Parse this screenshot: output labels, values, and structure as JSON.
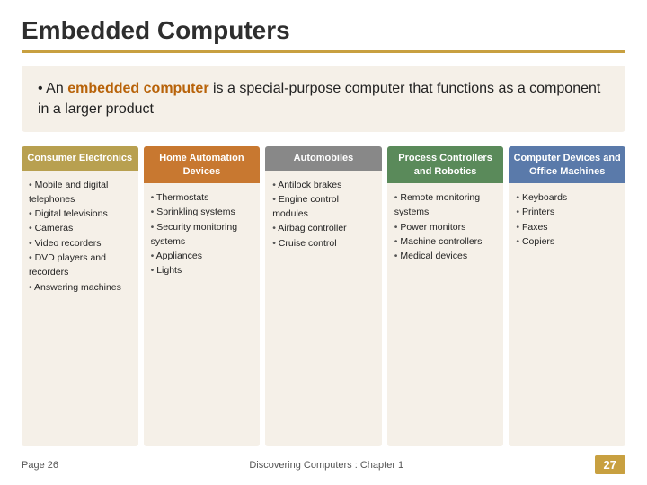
{
  "slide": {
    "title": "Embedded Computers",
    "bullet": {
      "prefix": "An ",
      "highlight": "embedded computer",
      "suffix": " is a special-purpose computer that functions as a component in a larger product"
    },
    "cards": [
      {
        "id": "consumer",
        "header": "Consumer Electronics",
        "colorClass": "card-consumer",
        "items": [
          "Mobile and digital telephones",
          "Digital televisions",
          "Cameras",
          "Video recorders",
          "DVD players and recorders",
          "Answering machines"
        ]
      },
      {
        "id": "home",
        "header": "Home Automation Devices",
        "colorClass": "card-home",
        "items": [
          "Thermostats",
          "Sprinkling systems",
          "Security monitoring systems",
          "Appliances",
          "Lights"
        ]
      },
      {
        "id": "auto",
        "header": "Automobiles",
        "colorClass": "card-auto",
        "items": [
          "Antilock brakes",
          "Engine control modules",
          "Airbag controller",
          "Cruise control"
        ]
      },
      {
        "id": "process",
        "header": "Process Controllers and Robotics",
        "colorClass": "card-process",
        "items": [
          "Remote monitoring systems",
          "Power monitors",
          "Machine controllers",
          "Medical devices"
        ]
      },
      {
        "id": "computer",
        "header": "Computer Devices and Office Machines",
        "colorClass": "card-computer",
        "items": [
          "Keyboards",
          "Printers",
          "Faxes",
          "Copiers"
        ]
      }
    ],
    "footer": {
      "page_label": "Page 26",
      "center_text": "Discovering Computers : Chapter 1",
      "page_num": "27"
    }
  }
}
